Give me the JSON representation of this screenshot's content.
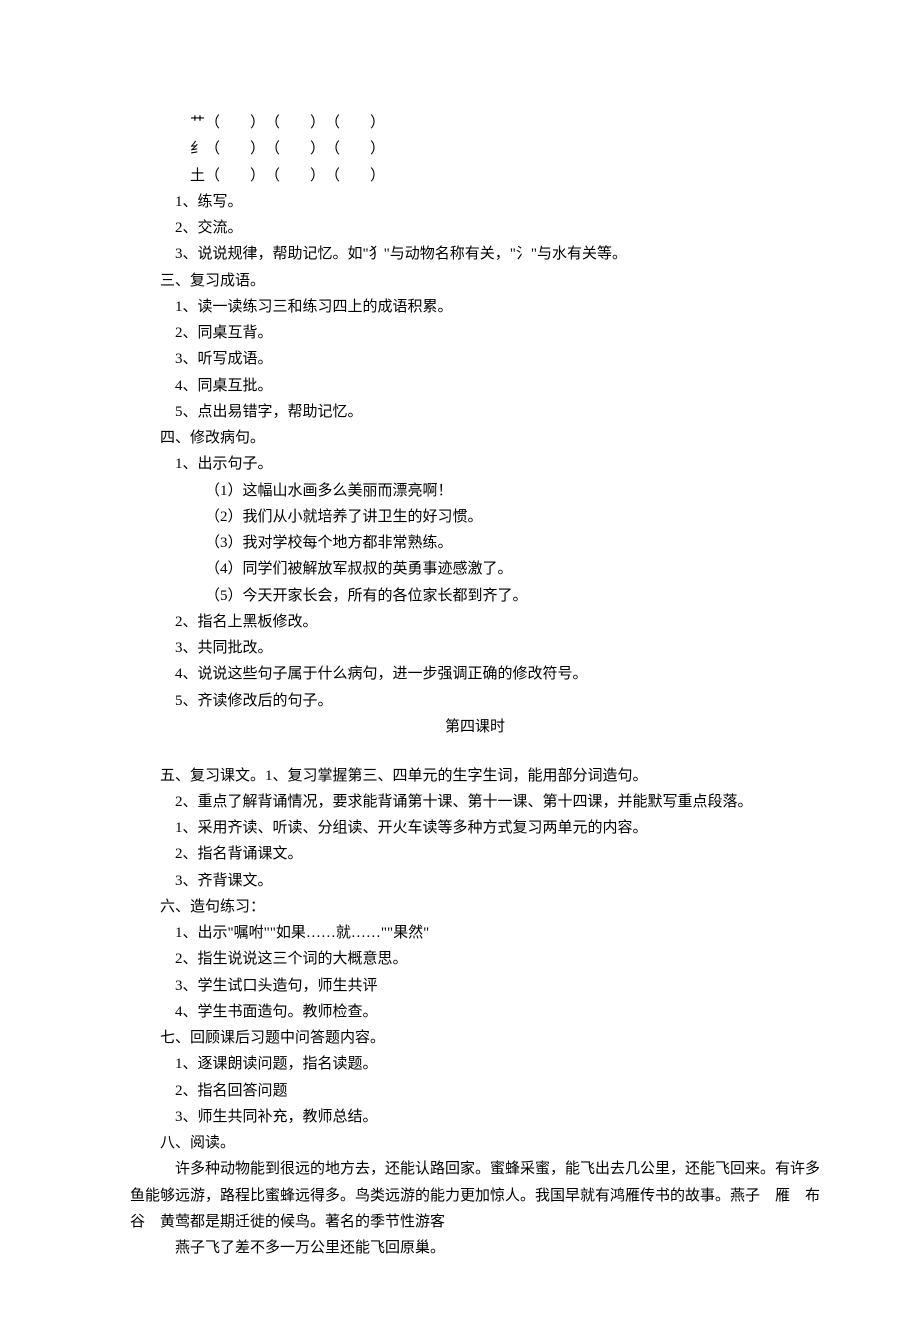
{
  "radicals": {
    "r1": "艹（　　）　（　　）　（　　）",
    "r2": "纟（　　）　（　　）　（　　）",
    "r3": "土（　　）　（　　）　（　　）"
  },
  "sec2": {
    "i1": "1、练写。",
    "i2": "2、交流。",
    "i3": "3、说说规律，帮助记忆。如\"犭\"与动物名称有关，\"氵\"与水有关等。"
  },
  "sec3": {
    "title": "三、复习成语。",
    "i1": "1、读一读练习三和练习四上的成语积累。",
    "i2": "2、同桌互背。",
    "i3": "3、听写成语。",
    "i4": "4、同桌互批。",
    "i5": "5、点出易错字，帮助记忆。"
  },
  "sec4": {
    "title": "四、修改病句。",
    "i1": "1、出示句子。",
    "s1": "（1）这幅山水画多么美丽而漂亮啊！",
    "s2": "（2）我们从小就培养了讲卫生的好习惯。",
    "s3": "（3）我对学校每个地方都非常熟练。",
    "s4": "（4）同学们被解放军叔叔的英勇事迹感激了。",
    "s5": "（5）今天开家长会，所有的各位家长都到齐了。",
    "i2": "2、指名上黑板修改。",
    "i3": "3、共同批改。",
    "i4": "4、说说这些句子属于什么病句，进一步强调正确的修改符号。",
    "i5": "5、齐读修改后的句子。"
  },
  "lesson4": "第四课时",
  "sec5": {
    "title": "五、复习课文。1、复习掌握第三、四单元的生字生词，能用部分词造句。",
    "i2": "2、重点了解背诵情况，要求能背诵第十课、第十一课、第十四课，并能默写重点段落。",
    "i1b": "1、采用齐读、听读、分组读、开火车读等多种方式复习两单元的内容。",
    "i2b": "2、指名背诵课文。",
    "i3b": "3、齐背课文。"
  },
  "sec6": {
    "title": "六、造句练习：",
    "i1": "1、出示\"嘱咐\"\"如果……就……\"\"果然\"",
    "i2": "2、指生说说这三个词的大概意思。",
    "i3": "3、学生试口头造句，师生共评",
    "i4": "4、学生书面造句。教师检查。"
  },
  "sec7": {
    "title": "七、回顾课后习题中问答题内容。",
    "i1": "1、逐课朗读问题，指名读题。",
    "i2": "2、指名回答问题",
    "i3": "3、师生共同补充，教师总结。"
  },
  "sec8": {
    "title": "八、阅读。",
    "p1": "许多种动物能到很远的地方去，还能认路回家。蜜蜂采蜜，能飞出去几公里，还能飞回来。有许多鱼能够远游，路程比蜜蜂远得多。鸟类远游的能力更加惊人。我国早就有鸿雁传书的故事。燕子　雁　布谷　黄莺都是期迁徙的候鸟。著名的季节性游客",
    "p2": "燕子飞了差不多一万公里还能飞回原巢。"
  }
}
